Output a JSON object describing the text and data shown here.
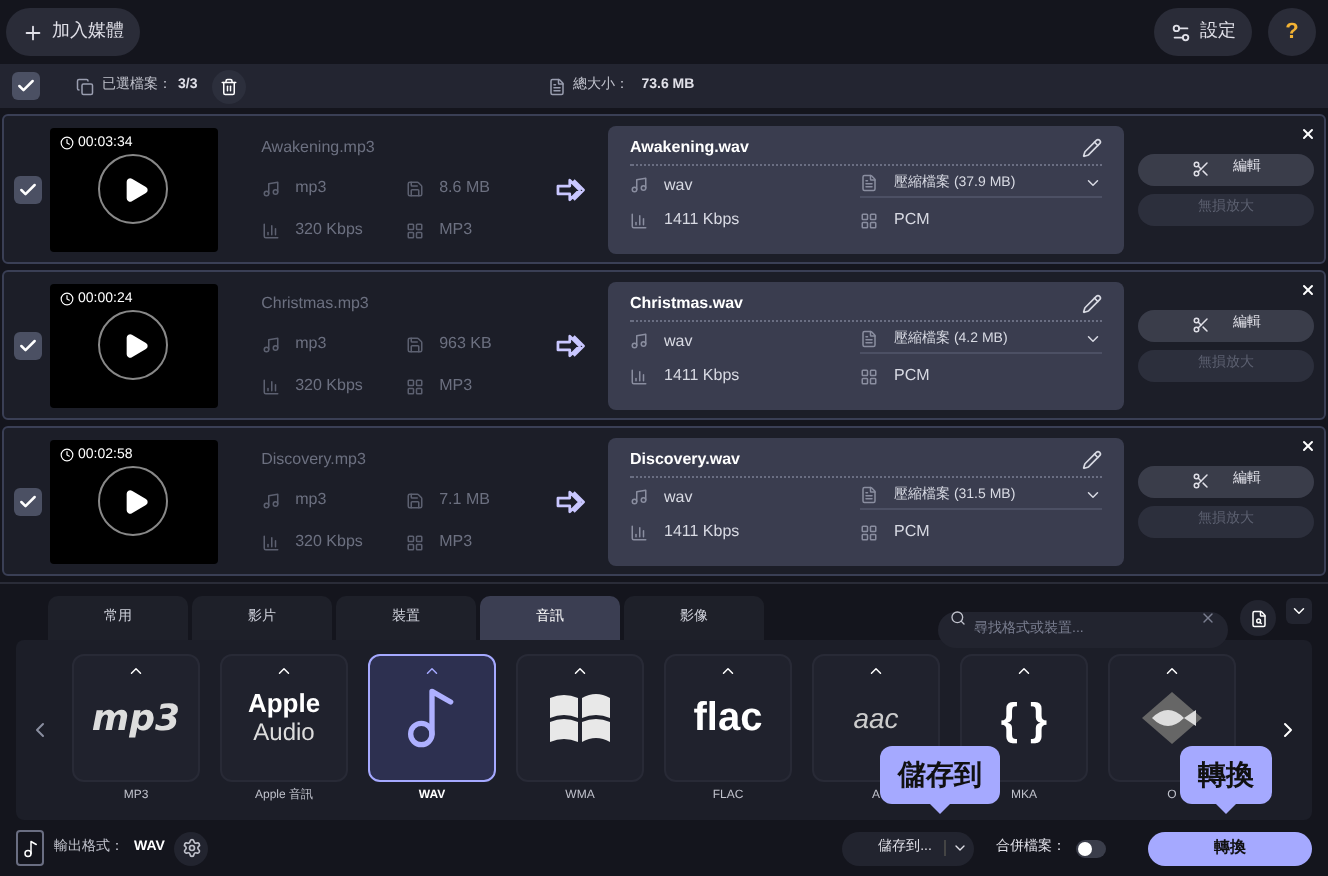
{
  "toolbar": {
    "add_button": "加入媒體",
    "settings_button": "設定",
    "help_button": "?"
  },
  "selection_bar": {
    "checked": true,
    "selected_label": "已選檔案：",
    "selected_count": "3/3",
    "total_label": "總大小：",
    "total_size": "73.6 MB"
  },
  "files": [
    {
      "checked": true,
      "duration": "00:03:34",
      "source_name": "Awakening.mp3",
      "source_format": "mp3",
      "source_size": "8.6 MB",
      "source_bitrate": "320 Kbps",
      "source_codec": "MP3",
      "output_name": "Awakening.wav",
      "output_format": "wav",
      "output_size": "壓縮檔案 (37.9 MB)",
      "output_bitrate": "1411 Kbps",
      "output_codec": "PCM",
      "edit_button": "編輯",
      "upscale_button": "無損放大",
      "upscale_disabled": true
    },
    {
      "checked": true,
      "duration": "00:00:24",
      "source_name": "Christmas.mp3",
      "source_format": "mp3",
      "source_size": "963 KB",
      "source_bitrate": "320 Kbps",
      "source_codec": "MP3",
      "output_name": "Christmas.wav",
      "output_format": "wav",
      "output_size": "壓縮檔案 (4.2 MB)",
      "output_bitrate": "1411 Kbps",
      "output_codec": "PCM",
      "edit_button": "編輯",
      "upscale_button": "無損放大",
      "upscale_disabled": true
    },
    {
      "checked": true,
      "duration": "00:02:58",
      "source_name": "Discovery.mp3",
      "source_format": "mp3",
      "source_size": "7.1 MB",
      "source_bitrate": "320 Kbps",
      "source_codec": "MP3",
      "output_name": "Discovery.wav",
      "output_format": "wav",
      "output_size": "壓縮檔案 (31.5 MB)",
      "output_bitrate": "1411 Kbps",
      "output_codec": "PCM",
      "edit_button": "編輯",
      "upscale_button": "無損放大",
      "upscale_disabled": true
    }
  ],
  "format_tabs": [
    {
      "label": "常用",
      "selected": false
    },
    {
      "label": "影片",
      "selected": false
    },
    {
      "label": "裝置",
      "selected": false
    },
    {
      "label": "音訊",
      "selected": true
    },
    {
      "label": "影像",
      "selected": false
    }
  ],
  "format_search": {
    "placeholder": "尋找格式或裝置..."
  },
  "formats": [
    {
      "kind": "mp3",
      "logo_text": "mp3",
      "label": "MP3",
      "selected": false
    },
    {
      "kind": "apple",
      "logo_text": "Apple",
      "logo_subtext": "Audio",
      "label": "Apple 音訊",
      "selected": false
    },
    {
      "kind": "note",
      "label": "WAV",
      "selected": true
    },
    {
      "kind": "windows",
      "label": "WMA",
      "selected": false
    },
    {
      "kind": "flac",
      "logo_text": "flac",
      "label": "FLAC",
      "selected": false
    },
    {
      "kind": "aac",
      "logo_text": "aac",
      "label": "A",
      "selected": false
    },
    {
      "kind": "braces",
      "logo_text": "{ }",
      "label": "MKA",
      "selected": false
    },
    {
      "kind": "fish",
      "label": "O",
      "selected": false
    }
  ],
  "footer": {
    "output_label": "輸出格式：",
    "output_format": "WAV",
    "save_button": "儲存到...",
    "merge_label": "合併檔案：",
    "merge_on": false,
    "convert_button": "轉換"
  },
  "tooltips": [
    {
      "kind": "save",
      "text": "儲存到"
    },
    {
      "kind": "convert",
      "text": "轉換"
    }
  ]
}
